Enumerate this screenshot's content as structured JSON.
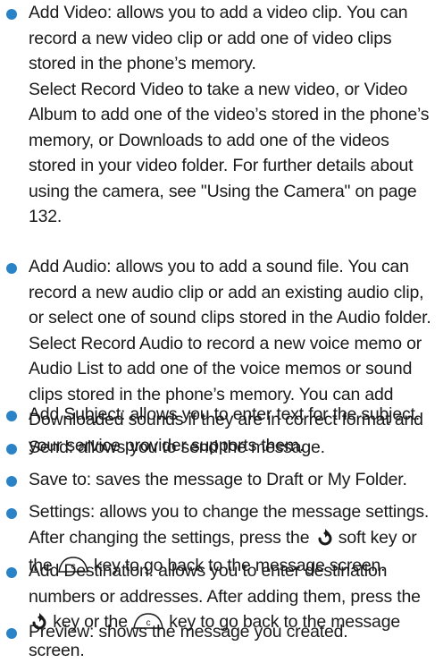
{
  "bullet_color": "#2a83c6",
  "items": [
    {
      "paragraphs": [
        "Add Video: allows you to add a video clip. You can record a new video clip or add one of video clips stored in the phone’s memory.",
        "Select Record Video to take a new video, or Video Album to add one of the video’s stored in the phone’s memory, or Downloads to add one of the videos stored in your video folder. For further details about using the camera, see \"Using the Camera\" on page 132."
      ]
    },
    {
      "paragraphs": [
        "Add Audio: allows you to add a sound file. You can record a new audio clip or add an existing audio clip, or select one of sound clips stored in the Audio folder.",
        "Select Record Audio to record a new voice memo or Audio List to add one of the voice memos or sound clips stored in the phone’s memory. You can add Downloaded sounds if they are in correct format and your service provider supports them."
      ]
    },
    {
      "text": "Add Subject: allows you to enter text for the subject."
    },
    {
      "text": "Send: allows you to send the message."
    },
    {
      "text": "Save to: saves the message to Draft or My Folder."
    },
    {
      "parts": {
        "a": "Settings: allows you to change the message settings.  After changing the settings, press the",
        "b": "soft key or the",
        "c": "key to go back to the message screen."
      }
    },
    {
      "parts": {
        "a": "Add Destination: allows you to enter destination numbers or addresses. After adding them, press the",
        "b": "key or the",
        "c": "key to go back to the message screen."
      }
    },
    {
      "text": "Preview: shows the message you created."
    }
  ],
  "icons": {
    "soft_key": "back-arrow-soft-key-icon",
    "clear_key": "c-clear-key-icon",
    "clear_key_letter": "c"
  }
}
